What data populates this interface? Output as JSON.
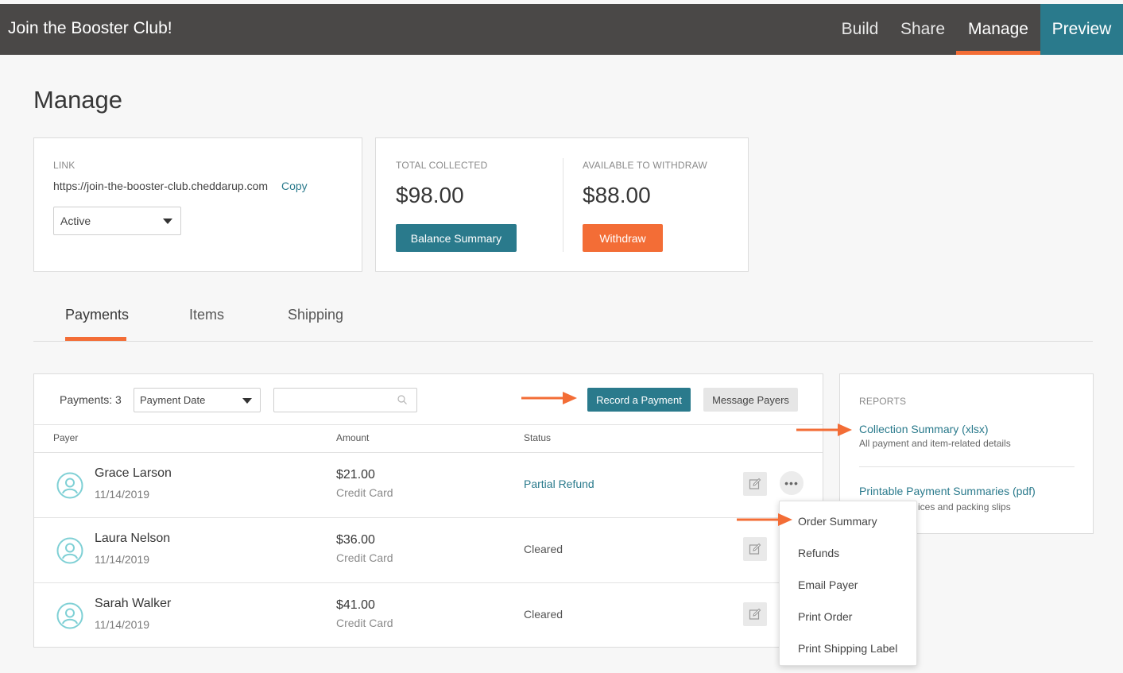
{
  "app": {
    "title": "Join the Booster Club!"
  },
  "nav": {
    "build": "Build",
    "share": "Share",
    "manage": "Manage",
    "preview": "Preview"
  },
  "page": {
    "title": "Manage"
  },
  "link_card": {
    "label": "LINK",
    "url": "https://join-the-booster-club.cheddarup.com",
    "copy": "Copy",
    "status_value": "Active"
  },
  "money": {
    "total_label": "TOTAL COLLECTED",
    "total_value": "$98.00",
    "available_label": "AVAILABLE TO WITHDRAW",
    "available_value": "$88.00",
    "balance_button": "Balance Summary",
    "withdraw_button": "Withdraw"
  },
  "tabs": [
    {
      "label": "Payments",
      "active": true
    },
    {
      "label": "Items"
    },
    {
      "label": "Shipping"
    }
  ],
  "payments": {
    "count_label": "Payments: 3",
    "sort_value": "Payment Date",
    "search_placeholder": "",
    "record_button": "Record a Payment",
    "message_button": "Message Payers",
    "columns": [
      "Payer",
      "Amount",
      "Status"
    ],
    "rows": [
      {
        "name": "Grace Larson",
        "date": "11/14/2019",
        "amount": "$21.00",
        "method": "Credit Card",
        "status": "Partial Refund"
      },
      {
        "name": "Laura Nelson",
        "date": "11/14/2019",
        "amount": "$36.00",
        "method": "Credit Card",
        "status": "Cleared"
      },
      {
        "name": "Sarah Walker",
        "date": "11/14/2019",
        "amount": "$41.00",
        "method": "Credit Card",
        "status": "Cleared"
      }
    ],
    "more_glyph": "•••"
  },
  "reports": {
    "label": "REPORTS",
    "items": [
      {
        "title": "Collection Summary (xlsx)",
        "desc": "All payment and item-related details"
      },
      {
        "title": "Printable Payment Summaries (pdf)",
        "desc": "ices and packing slips"
      }
    ]
  },
  "menu": {
    "items": [
      "Order Summary",
      "Refunds",
      "Email Payer",
      "Print Order",
      "Print Shipping Label"
    ]
  },
  "colors": {
    "accent_orange": "#f36d36",
    "teal": "#2a7a8c",
    "topbar": "#4a4847"
  }
}
